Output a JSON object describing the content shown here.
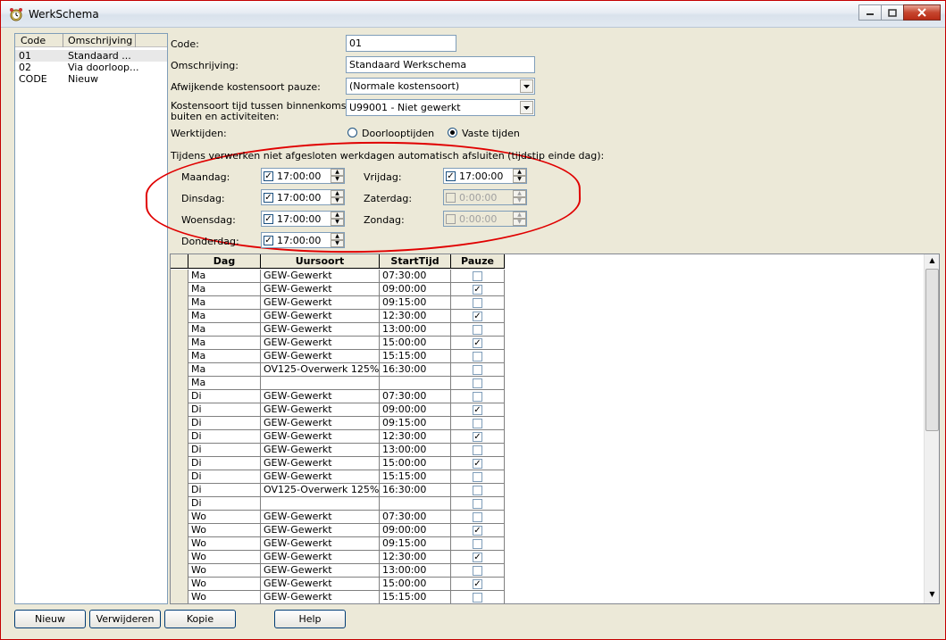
{
  "window": {
    "title": "WerkSchema"
  },
  "list": {
    "headers": [
      "Code",
      "Omschrijving"
    ],
    "rows": [
      {
        "code": "01",
        "omschrijving": "Standaard ..."
      },
      {
        "code": "02",
        "omschrijving": "Via doorloop..."
      },
      {
        "code": "CODE",
        "omschrijving": "Nieuw"
      }
    ]
  },
  "form": {
    "code_label": "Code:",
    "code_value": "01",
    "omschrijving_label": "Omschrijving:",
    "omschrijving_value": "Standaard Werkschema",
    "afwijkende_label": "Afwijkende kostensoort pauze:",
    "afwijkende_value": "(Normale kostensoort)",
    "kostensoort_label_1": "Kostensoort tijd tussen binnenkomst/naar",
    "kostensoort_label_2": "buiten en activiteiten:",
    "kostensoort_value": "U99001 - Niet gewerkt",
    "werktijden_label": "Werktijden:",
    "radio_doorloop": "Doorlooptijden",
    "radio_vaste": "Vaste tijden",
    "selected_radio": "vaste"
  },
  "autoclose": {
    "title": "Tijdens verwerken niet afgesloten werkdagen automatisch afsluiten (tijdstip einde dag):",
    "days": [
      {
        "label": "Maandag:",
        "checked": true,
        "time": "17:00:00",
        "enabled": true
      },
      {
        "label": "Dinsdag:",
        "checked": true,
        "time": "17:00:00",
        "enabled": true
      },
      {
        "label": "Woensdag:",
        "checked": true,
        "time": "17:00:00",
        "enabled": true
      },
      {
        "label": "Donderdag:",
        "checked": true,
        "time": "17:00:00",
        "enabled": true
      },
      {
        "label": "Vrijdag:",
        "checked": true,
        "time": "17:00:00",
        "enabled": true
      },
      {
        "label": "Zaterdag:",
        "checked": false,
        "time": "0:00:00",
        "enabled": false
      },
      {
        "label": "Zondag:",
        "checked": false,
        "time": "0:00:00",
        "enabled": false
      }
    ]
  },
  "grid": {
    "headers": [
      "Dag",
      "Uursoort",
      "StartTijd",
      "Pauze"
    ],
    "rows": [
      {
        "dag": "Ma",
        "uursoort": "GEW-Gewerkt",
        "start": "07:30:00",
        "pauze": false
      },
      {
        "dag": "Ma",
        "uursoort": "GEW-Gewerkt",
        "start": "09:00:00",
        "pauze": true
      },
      {
        "dag": "Ma",
        "uursoort": "GEW-Gewerkt",
        "start": "09:15:00",
        "pauze": false
      },
      {
        "dag": "Ma",
        "uursoort": "GEW-Gewerkt",
        "start": "12:30:00",
        "pauze": true
      },
      {
        "dag": "Ma",
        "uursoort": "GEW-Gewerkt",
        "start": "13:00:00",
        "pauze": false
      },
      {
        "dag": "Ma",
        "uursoort": "GEW-Gewerkt",
        "start": "15:00:00",
        "pauze": true
      },
      {
        "dag": "Ma",
        "uursoort": "GEW-Gewerkt",
        "start": "15:15:00",
        "pauze": false
      },
      {
        "dag": "Ma",
        "uursoort": "OV125-Overwerk 125%",
        "start": "16:30:00",
        "pauze": false
      },
      {
        "dag": "Ma",
        "uursoort": "",
        "start": "",
        "pauze": false
      },
      {
        "dag": "Di",
        "uursoort": "GEW-Gewerkt",
        "start": "07:30:00",
        "pauze": false
      },
      {
        "dag": "Di",
        "uursoort": "GEW-Gewerkt",
        "start": "09:00:00",
        "pauze": true
      },
      {
        "dag": "Di",
        "uursoort": "GEW-Gewerkt",
        "start": "09:15:00",
        "pauze": false
      },
      {
        "dag": "Di",
        "uursoort": "GEW-Gewerkt",
        "start": "12:30:00",
        "pauze": true
      },
      {
        "dag": "Di",
        "uursoort": "GEW-Gewerkt",
        "start": "13:00:00",
        "pauze": false
      },
      {
        "dag": "Di",
        "uursoort": "GEW-Gewerkt",
        "start": "15:00:00",
        "pauze": true
      },
      {
        "dag": "Di",
        "uursoort": "GEW-Gewerkt",
        "start": "15:15:00",
        "pauze": false
      },
      {
        "dag": "Di",
        "uursoort": "OV125-Overwerk 125%",
        "start": "16:30:00",
        "pauze": false
      },
      {
        "dag": "Di",
        "uursoort": "",
        "start": "",
        "pauze": false
      },
      {
        "dag": "Wo",
        "uursoort": "GEW-Gewerkt",
        "start": "07:30:00",
        "pauze": false
      },
      {
        "dag": "Wo",
        "uursoort": "GEW-Gewerkt",
        "start": "09:00:00",
        "pauze": true
      },
      {
        "dag": "Wo",
        "uursoort": "GEW-Gewerkt",
        "start": "09:15:00",
        "pauze": false
      },
      {
        "dag": "Wo",
        "uursoort": "GEW-Gewerkt",
        "start": "12:30:00",
        "pauze": true
      },
      {
        "dag": "Wo",
        "uursoort": "GEW-Gewerkt",
        "start": "13:00:00",
        "pauze": false
      },
      {
        "dag": "Wo",
        "uursoort": "GEW-Gewerkt",
        "start": "15:00:00",
        "pauze": true
      },
      {
        "dag": "Wo",
        "uursoort": "GEW-Gewerkt",
        "start": "15:15:00",
        "pauze": false
      }
    ]
  },
  "buttons": {
    "nieuw": "Nieuw",
    "verwijderen": "Verwijderen",
    "kopie": "Kopie",
    "help": "Help"
  },
  "colors": {
    "annotation": "#e00000",
    "window_border": "#c40000"
  }
}
